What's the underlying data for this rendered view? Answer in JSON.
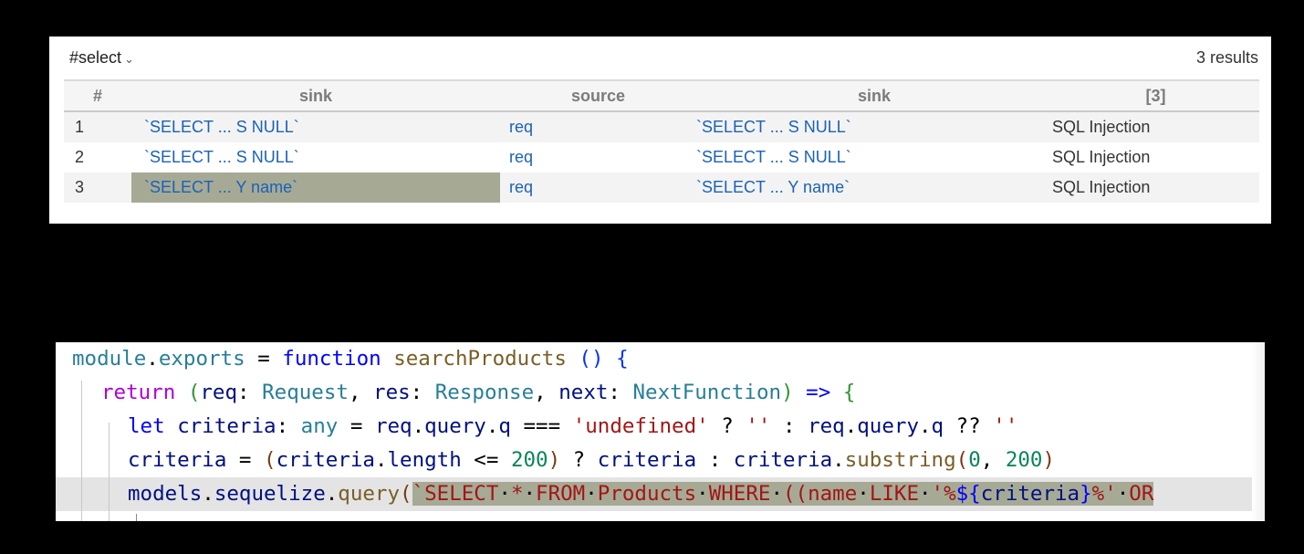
{
  "results_panel": {
    "query_name": "#select",
    "dropdown_icon": "chevron-down-icon",
    "result_count": "3 results",
    "columns": [
      "#",
      "sink",
      "source",
      "sink",
      "[3]"
    ],
    "rows": [
      {
        "num": "1",
        "sink": "`SELECT ... S NULL`",
        "source": "req",
        "sink2": "`SELECT ... S NULL`",
        "type": "SQL Injection"
      },
      {
        "num": "2",
        "sink": "`SELECT ... S NULL`",
        "source": "req",
        "sink2": "`SELECT ... S NULL`",
        "type": "SQL Injection"
      },
      {
        "num": "3",
        "sink": "`SELECT ... Y name`",
        "source": "req",
        "sink2": "`SELECT ... Y name`",
        "type": "SQL Injection"
      }
    ],
    "selected_row": 3,
    "selection_color": "#a6aa95"
  },
  "code_panel": {
    "lines": [
      {
        "tokens": [
          [
            "module",
            "mod"
          ],
          [
            ".",
            "op"
          ],
          [
            "exports",
            "mod"
          ],
          [
            " = ",
            "op"
          ],
          [
            "function",
            "kw"
          ],
          [
            " ",
            "op"
          ],
          [
            "searchProducts",
            "fn"
          ],
          [
            " ",
            "op"
          ],
          [
            "()",
            "p1"
          ],
          [
            " ",
            "op"
          ],
          [
            "{",
            "p1"
          ]
        ]
      },
      {
        "tokens": [
          [
            "return",
            "ctl"
          ],
          [
            " ",
            "op"
          ],
          [
            "(",
            "p2"
          ],
          [
            "req",
            "var"
          ],
          [
            ": ",
            "op"
          ],
          [
            "Request",
            "type"
          ],
          [
            ", ",
            "op"
          ],
          [
            "res",
            "var"
          ],
          [
            ": ",
            "op"
          ],
          [
            "Response",
            "type"
          ],
          [
            ", ",
            "op"
          ],
          [
            "next",
            "var"
          ],
          [
            ": ",
            "op"
          ],
          [
            "NextFunction",
            "type"
          ],
          [
            ")",
            "p2"
          ],
          [
            " ",
            "op"
          ],
          [
            "=>",
            "kw"
          ],
          [
            " ",
            "op"
          ],
          [
            "{",
            "p2"
          ]
        ]
      },
      {
        "tokens": [
          [
            "let",
            "kw"
          ],
          [
            " ",
            "op"
          ],
          [
            "criteria",
            "var"
          ],
          [
            ": ",
            "op"
          ],
          [
            "any",
            "type"
          ],
          [
            " = ",
            "op"
          ],
          [
            "req",
            "var"
          ],
          [
            ".",
            "op"
          ],
          [
            "query",
            "var"
          ],
          [
            ".",
            "op"
          ],
          [
            "q",
            "var"
          ],
          [
            " === ",
            "op"
          ],
          [
            "'undefined'",
            "str"
          ],
          [
            " ? ",
            "op"
          ],
          [
            "''",
            "str"
          ],
          [
            " : ",
            "op"
          ],
          [
            "req",
            "var"
          ],
          [
            ".",
            "op"
          ],
          [
            "query",
            "var"
          ],
          [
            ".",
            "op"
          ],
          [
            "q",
            "var"
          ],
          [
            " ?? ",
            "op"
          ],
          [
            "''",
            "str"
          ]
        ]
      },
      {
        "tokens": [
          [
            "criteria",
            "var"
          ],
          [
            " = ",
            "op"
          ],
          [
            "(",
            "p3"
          ],
          [
            "criteria",
            "var"
          ],
          [
            ".",
            "op"
          ],
          [
            "length",
            "var"
          ],
          [
            " <= ",
            "op"
          ],
          [
            "200",
            "num"
          ],
          [
            ")",
            "p3"
          ],
          [
            " ? ",
            "op"
          ],
          [
            "criteria",
            "var"
          ],
          [
            " : ",
            "op"
          ],
          [
            "criteria",
            "var"
          ],
          [
            ".",
            "op"
          ],
          [
            "substring",
            "fn"
          ],
          [
            "(",
            "p3"
          ],
          [
            "0",
            "num"
          ],
          [
            ", ",
            "op"
          ],
          [
            "200",
            "num"
          ],
          [
            ")",
            "p3"
          ]
        ]
      },
      {
        "tokens": [
          [
            "models",
            "var"
          ],
          [
            ".",
            "op"
          ],
          [
            "sequelize",
            "var"
          ],
          [
            ".",
            "op"
          ],
          [
            "query",
            "fn"
          ],
          [
            "(",
            "p3"
          ]
        ],
        "highlighted_tokens": [
          [
            "`SELECT",
            "str"
          ],
          [
            "·",
            "dot"
          ],
          [
            "*",
            "str"
          ],
          [
            "·",
            "dot"
          ],
          [
            "FROM",
            "str"
          ],
          [
            "·",
            "dot"
          ],
          [
            "Products",
            "str"
          ],
          [
            "·",
            "dot"
          ],
          [
            "WHERE",
            "str"
          ],
          [
            "·",
            "dot"
          ],
          [
            "((name",
            "str"
          ],
          [
            "·",
            "dot"
          ],
          [
            "LIKE",
            "str"
          ],
          [
            "·",
            "dot"
          ],
          [
            "'%",
            "str"
          ],
          [
            "${",
            "kw"
          ],
          [
            "criteria",
            "var"
          ],
          [
            "}",
            "kw"
          ],
          [
            "%'",
            "str"
          ],
          [
            "·",
            "dot"
          ],
          [
            "OR",
            "str"
          ]
        ]
      }
    ]
  }
}
